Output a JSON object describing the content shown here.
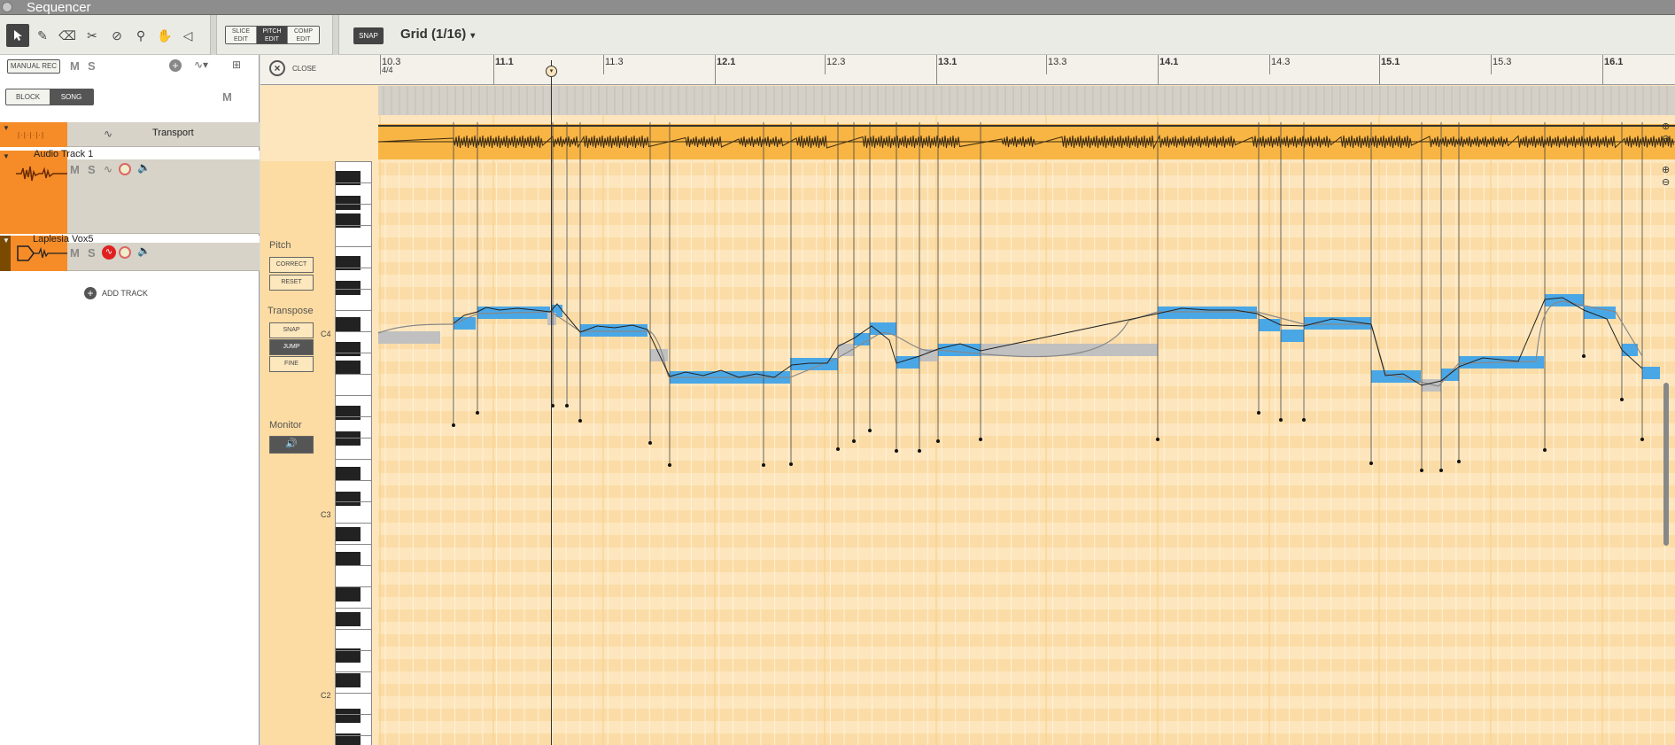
{
  "window": {
    "title": "Sequencer"
  },
  "toolbar": {
    "tools": [
      "arrow-tool-icon",
      "pencil-tool-icon",
      "eraser-tool-icon",
      "razor-tool-icon",
      "mute-tool-icon",
      "magnify-tool-icon",
      "hand-tool-icon",
      "speaker-tool-icon"
    ],
    "edit_modes": [
      {
        "line1": "SLICE",
        "line2": "EDIT",
        "active": false
      },
      {
        "line1": "PITCH",
        "line2": "EDIT",
        "active": true
      },
      {
        "line1": "COMP",
        "line2": "EDIT",
        "active": false
      }
    ],
    "snap_label": "SNAP",
    "grid_label": "Grid (1/16)"
  },
  "left_panel": {
    "manual_rec": "MANUAL REC",
    "m_label": "M",
    "s_label": "S",
    "block_label": "BLOCK",
    "song_label": "SONG",
    "transport_name": "Transport",
    "tracks": [
      {
        "name": "Audio Track 1",
        "m": "M",
        "s": "S"
      },
      {
        "name": "Laplesia Vox5",
        "m": "M",
        "s": "S"
      }
    ],
    "add_track": "ADD TRACK"
  },
  "editor": {
    "close_label": "CLOSE",
    "ruler": [
      {
        "label": "10.3",
        "sub": "4/4",
        "major": false
      },
      {
        "label": "11.1",
        "major": true
      },
      {
        "label": "11.3",
        "major": false
      },
      {
        "label": "12.1",
        "major": true
      },
      {
        "label": "12.3",
        "major": false
      },
      {
        "label": "13.1",
        "major": true
      },
      {
        "label": "13.3",
        "major": false
      },
      {
        "label": "14.1",
        "major": true
      },
      {
        "label": "14.3",
        "major": false
      },
      {
        "label": "15.1",
        "major": true
      },
      {
        "label": "15.3",
        "major": false
      },
      {
        "label": "16.1",
        "major": true
      }
    ],
    "pitch_label": "Pitch",
    "correct_label": "CORRECT",
    "reset_label": "RESET",
    "transpose_label": "Transpose",
    "snap_label": "SNAP",
    "jump_label": "JUMP",
    "fine_label": "FINE",
    "monitor_label": "Monitor",
    "octave_labels": [
      "C4",
      "C3",
      "C2"
    ]
  },
  "colors": {
    "note_blue": "#4aa7e6",
    "note_gray": "#c0c0c0",
    "track_orange": "#f58c28",
    "bg_peach": "#fde6bd"
  }
}
